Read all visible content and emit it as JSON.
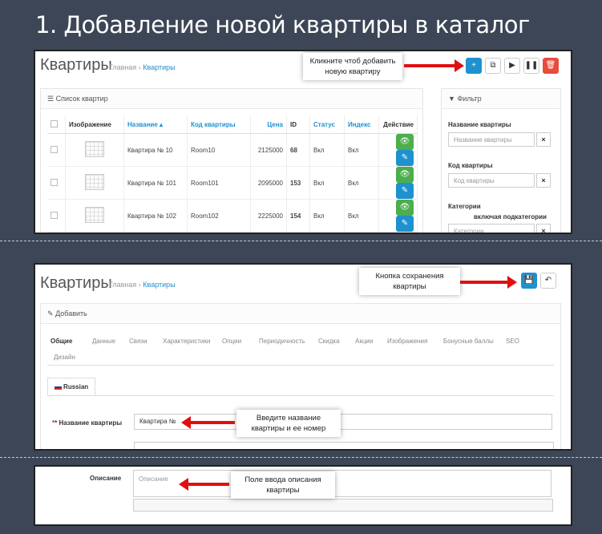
{
  "heading": "1. Добавление новой квартиры в каталог",
  "screen1": {
    "page_title": "Квартиры",
    "breadcrumb_home": "Главная",
    "breadcrumb_sep": "›",
    "breadcrumb_current": "Квартиры",
    "callout": "Кликните чтоб добавить новую квартиру",
    "list_title": "Список квартир",
    "columns": {
      "image": "Изображение",
      "name": "Название ▴",
      "code": "Код квартиры",
      "price": "Цена",
      "id": "ID",
      "status": "Статус",
      "index": "Индекс",
      "action": "Действие"
    },
    "rows": [
      {
        "name": "Квартира № 10",
        "code": "Room10",
        "price": "2125000",
        "id": "68",
        "status": "Вкл",
        "index": "Вкл"
      },
      {
        "name": "Квартира № 101",
        "code": "Room101",
        "price": "2095000",
        "id": "153",
        "status": "Вкл",
        "index": "Вкл"
      },
      {
        "name": "Квартира № 102",
        "code": "Room102",
        "price": "2225000",
        "id": "154",
        "status": "Вкл",
        "index": "Вкл"
      }
    ],
    "filter": {
      "title": "Фильтр",
      "name_label": "Название квартиры",
      "name_placeholder": "Название квартиры",
      "code_label": "Код квартиры",
      "code_placeholder": "Код квартиры",
      "cat_label": "Категории",
      "cat_sub": "включая подкатегории",
      "cat_placeholder": "Категории",
      "clear": "×"
    }
  },
  "screen2": {
    "page_title": "Квартиры",
    "breadcrumb_home": "Главная",
    "breadcrumb_sep": "›",
    "breadcrumb_current": "Квартиры",
    "callout": "Кнопка сохранения квартиры",
    "panel_title": "Добавить",
    "tabs": [
      "Общие",
      "Данные",
      "Связи",
      "Характеристики",
      "Опции",
      "Периодичность",
      "Скидка",
      "Акции",
      "Изображения",
      "Бонусные баллы",
      "SEO",
      "Дизайн"
    ],
    "lang_tab": "Russian",
    "name_label": "* Название квартиры",
    "name_value": "Квартира №",
    "callout_name": "Введите название квартиры и ее номер"
  },
  "screen3": {
    "desc_label": "Описание",
    "desc_placeholder": "Описание",
    "callout_desc": "Поле ввода описания квартиры"
  },
  "colors": {
    "background": "#3d4656",
    "primary": "#1e91cf",
    "danger": "#e74c3c",
    "success": "#4cae4c",
    "arrow": "#e01010"
  }
}
